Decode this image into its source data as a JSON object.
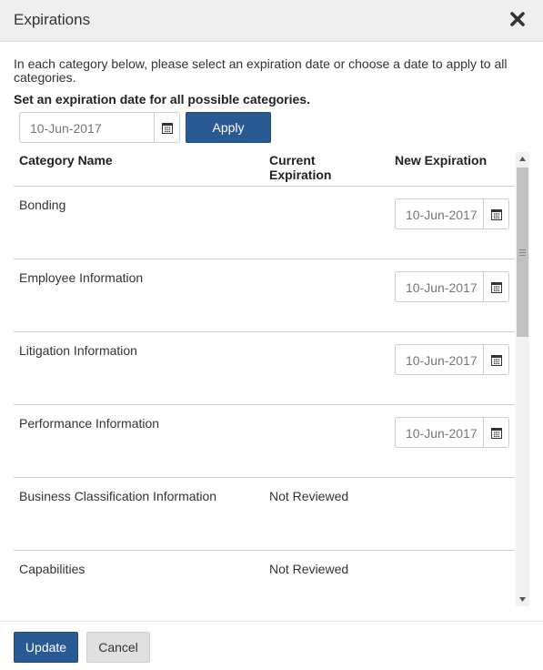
{
  "dialog": {
    "title": "Expirations"
  },
  "intro_text": "In each category below, please select an expiration date or choose a date to apply to all categories.",
  "bulk": {
    "label": "Set an expiration date for all possible categories.",
    "date_value": "10-Jun-2017",
    "apply_label": "Apply"
  },
  "table": {
    "columns": {
      "category": "Category Name",
      "current": "Current Expiration",
      "new": "New Expiration"
    },
    "rows": [
      {
        "name": "Bonding",
        "current": "",
        "new_expiration": "10-Jun-2017"
      },
      {
        "name": "Employee Information",
        "current": "",
        "new_expiration": "10-Jun-2017"
      },
      {
        "name": "Litigation Information",
        "current": "",
        "new_expiration": "10-Jun-2017"
      },
      {
        "name": "Performance Information",
        "current": "",
        "new_expiration": "10-Jun-2017"
      },
      {
        "name": "Business Classification Information",
        "current": "Not Reviewed",
        "new_expiration": ""
      },
      {
        "name": "Capabilities",
        "current": "Not Reviewed",
        "new_expiration": ""
      }
    ]
  },
  "footer": {
    "update_label": "Update",
    "cancel_label": "Cancel"
  },
  "icons": {
    "close": "close-icon",
    "calendar": "calendar-icon",
    "scroll_up": "scroll-up-arrow",
    "scroll_down": "scroll-down-arrow"
  },
  "colors": {
    "primary": "#2a5a94",
    "header_bg": "#efefef",
    "secondary_button": "#e0e0e0"
  }
}
